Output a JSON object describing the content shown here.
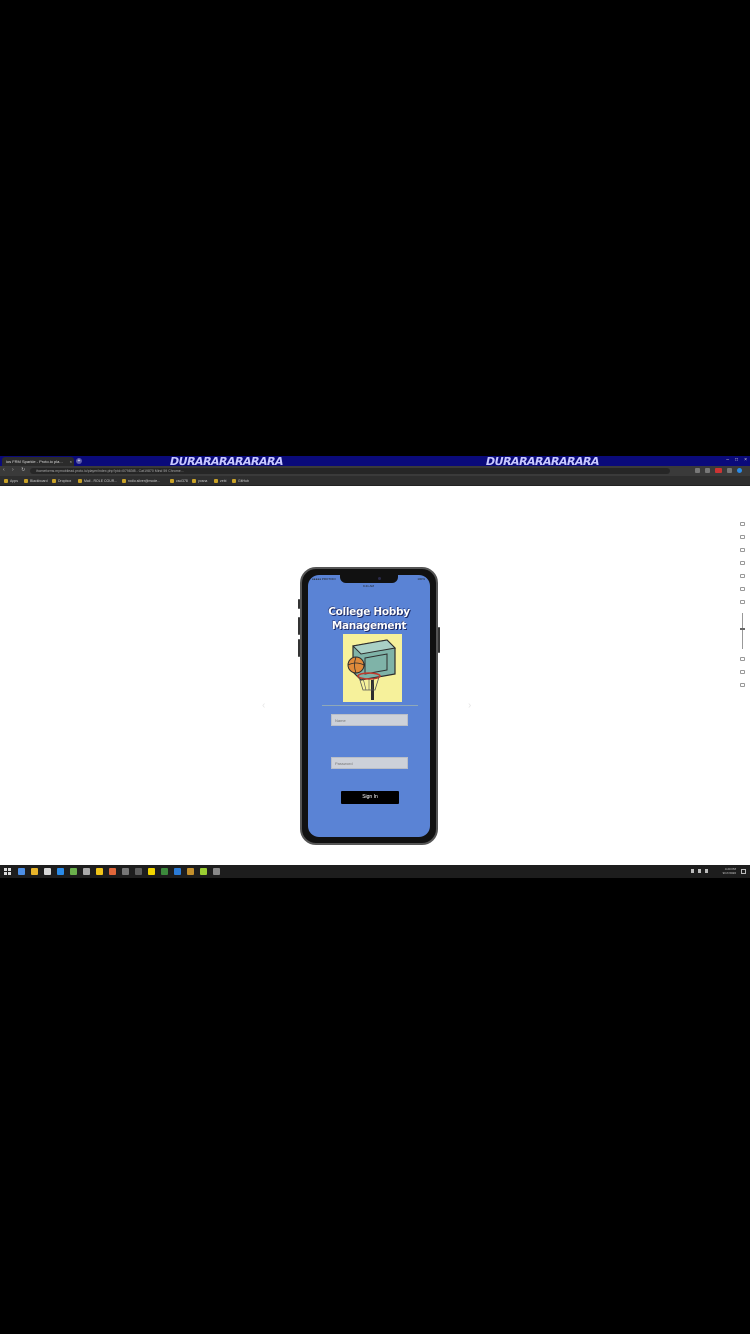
{
  "browser": {
    "tab_title": "ios FRM Sparkle - Proto.io pla...",
    "tab_close": "×",
    "new_tab": "+",
    "banner_text": "DURARARARARARA",
    "window_controls": [
      "–",
      "□",
      "×"
    ],
    "nav_buttons": "‹ › ↻",
    "url": "ihomeforms.mymobilead.proto.io/player/index.php?pid=i07983f8 - Cat19870 Mind 59 Chrome..."
  },
  "bookmarks": [
    "Apps",
    "Blackboard",
    "Dropbox",
    "Mail - ROLE COUR...",
    "rodlo.silver@mode...",
    "csci378",
    "yosna",
    "zebi",
    "GitHub"
  ],
  "phone": {
    "status_left": "●●●●● PROTOIO",
    "status_center": "9:41 AM",
    "status_right": "100%",
    "title_line1": "College Hobby",
    "title_line2": "Management",
    "hero_icon": "basketball-hoop-icon",
    "username_placeholder": "Name",
    "password_placeholder": "Password",
    "signin_label": "Sign In"
  },
  "canvas": {
    "prev_arrow": "‹",
    "next_arrow": "›"
  },
  "taskbar": {
    "time": "4:20 PM",
    "date": "9/17/2020",
    "app_colors": [
      "#4d8fe6",
      "#e8b42a",
      "#d8d8d8",
      "#2a8be8",
      "#6ab04c",
      "#aaaaaa",
      "#f0c419",
      "#e0663a",
      "#777777",
      "#5d5d5d",
      "#f2d600",
      "#3c8a3c",
      "#2b7bd6",
      "#c28f2c",
      "#9acd32",
      "#888888"
    ]
  },
  "colors": {
    "phone_screen": "#5a83d5",
    "tab_bar": "#0a0a7a",
    "hero_bg": "#f6f19b"
  }
}
